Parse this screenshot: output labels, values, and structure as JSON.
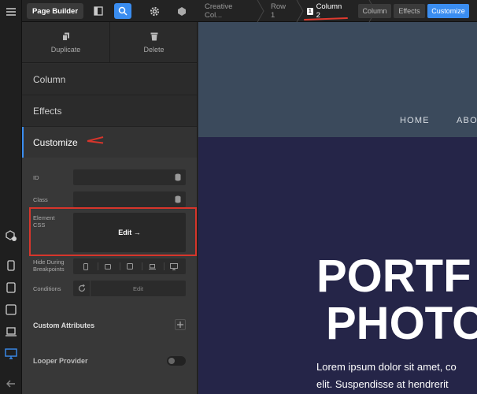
{
  "topbar": {
    "page_builder_label": "Page Builder",
    "breadcrumbs": [
      {
        "label": "Creative Col..."
      },
      {
        "label": "Row 1"
      },
      {
        "label": "Column 2",
        "number": "1"
      }
    ],
    "modes": [
      {
        "label": "Column",
        "active": false
      },
      {
        "label": "Effects",
        "active": false
      },
      {
        "label": "Customize",
        "active": true
      }
    ]
  },
  "panel": {
    "actions": [
      {
        "label": "Duplicate",
        "icon": "copy-icon"
      },
      {
        "label": "Delete",
        "icon": "trash-icon"
      }
    ],
    "tabs": [
      {
        "label": "Column"
      },
      {
        "label": "Effects"
      },
      {
        "label": "Customize"
      }
    ],
    "fields": {
      "id_label": "ID",
      "id_value": "",
      "class_label": "Class",
      "class_value": "",
      "element_css_label": "Element CSS",
      "element_css_button": "Edit →",
      "hide_label": "Hide During Breakpoints",
      "conditions_label": "Conditions",
      "conditions_button": "Edit"
    },
    "custom_attributes_label": "Custom Attributes",
    "looper_provider_label": "Looper Provider",
    "looper_provider_enabled": false
  },
  "preview": {
    "nav": [
      "HOME",
      "ABO"
    ],
    "hero_title_lines": [
      "PORTF",
      "PHOTO"
    ],
    "hero_text_lines": [
      "Lorem ipsum dolor sit amet, co",
      "elit. Suspendisse at hendrerit"
    ]
  },
  "colors": {
    "accent": "#3a8df0",
    "highlight": "#d7352b",
    "header_band": "#3b4a5c",
    "hero_bg": "#252548"
  }
}
